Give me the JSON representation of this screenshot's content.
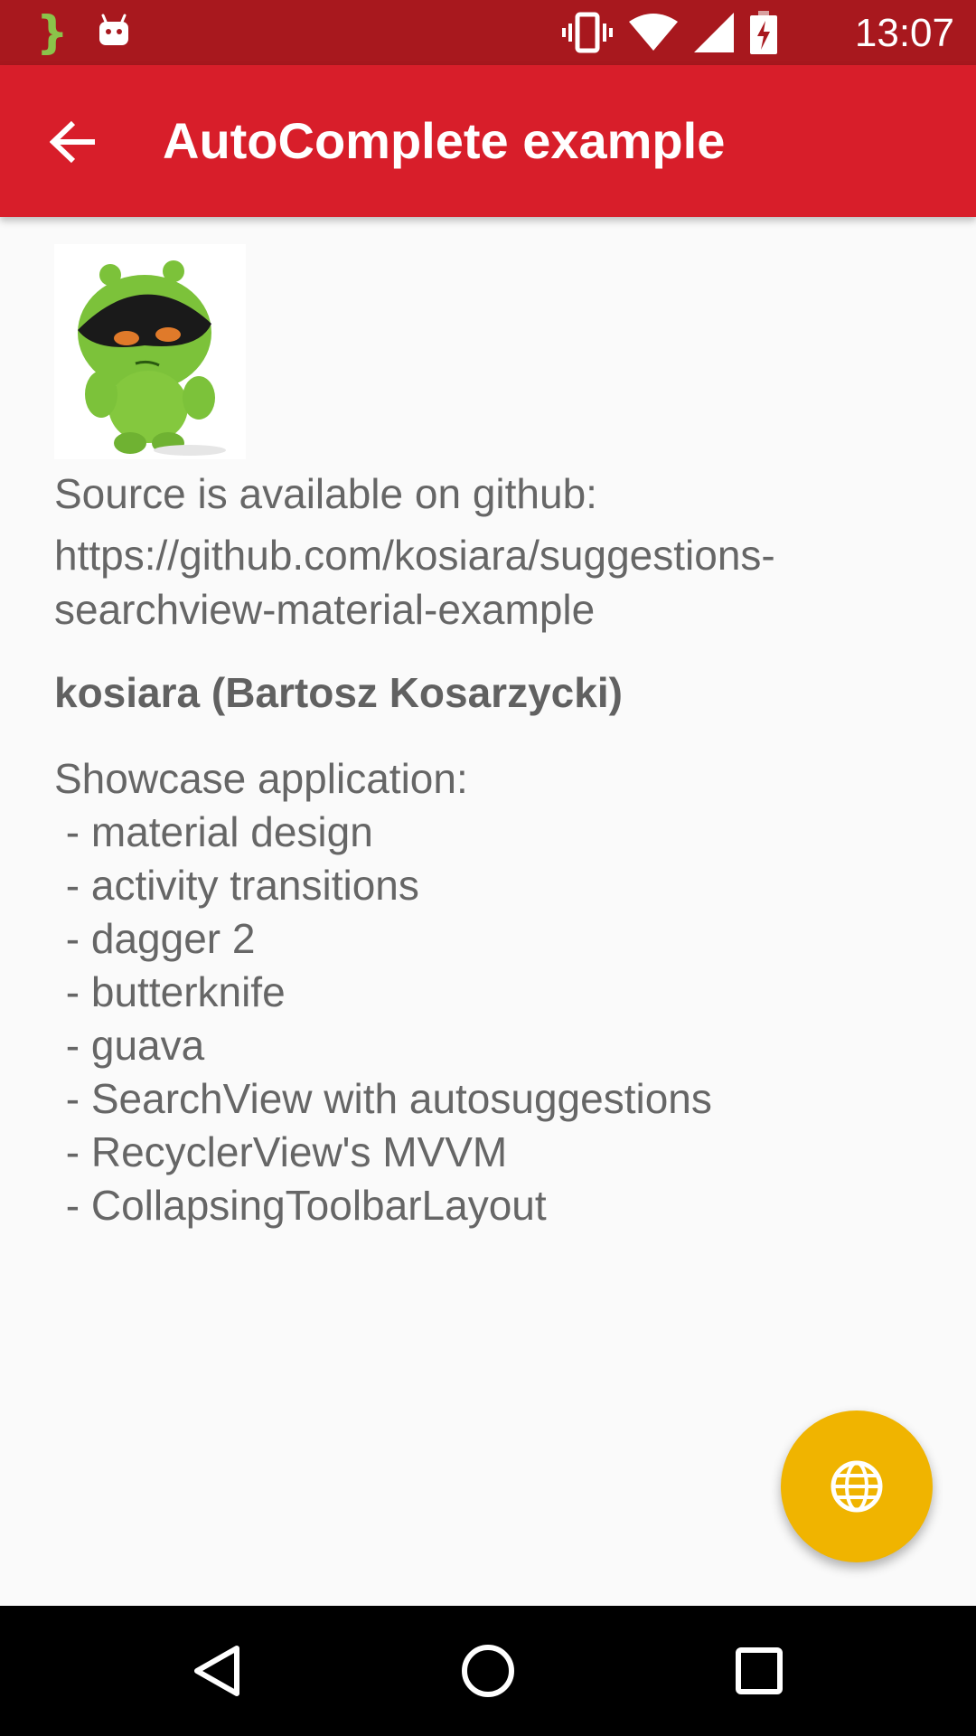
{
  "status_bar": {
    "time": "13:07",
    "notification_icons": [
      "brace-icon",
      "android-icon"
    ],
    "system_icons": [
      "vibrate-icon",
      "wifi-icon",
      "signal-icon",
      "battery-charging-icon"
    ]
  },
  "toolbar": {
    "title": "AutoComplete example",
    "back_icon": "arrow-back-icon",
    "background_color": "#d81e2a"
  },
  "content": {
    "source_line": "Source is available on github:",
    "url_line1": "https://github.com/kosiara/suggestions-",
    "url_line2": "searchview-material-example",
    "author": "kosiara (Bartosz Kosarzycki)",
    "description_title": "Showcase application:",
    "description_items": [
      " - material design",
      " - activity transitions",
      " - dagger 2",
      " - butterknife",
      " - guava",
      " - SearchView with autosuggestions",
      " - RecyclerView's MVVM",
      " - CollapsingToolbarLayout"
    ]
  },
  "fab": {
    "icon": "globe-icon",
    "color": "#f0b400"
  },
  "nav_bar": {
    "buttons": [
      "back-triangle-icon",
      "home-circle-icon",
      "recents-square-icon"
    ]
  }
}
